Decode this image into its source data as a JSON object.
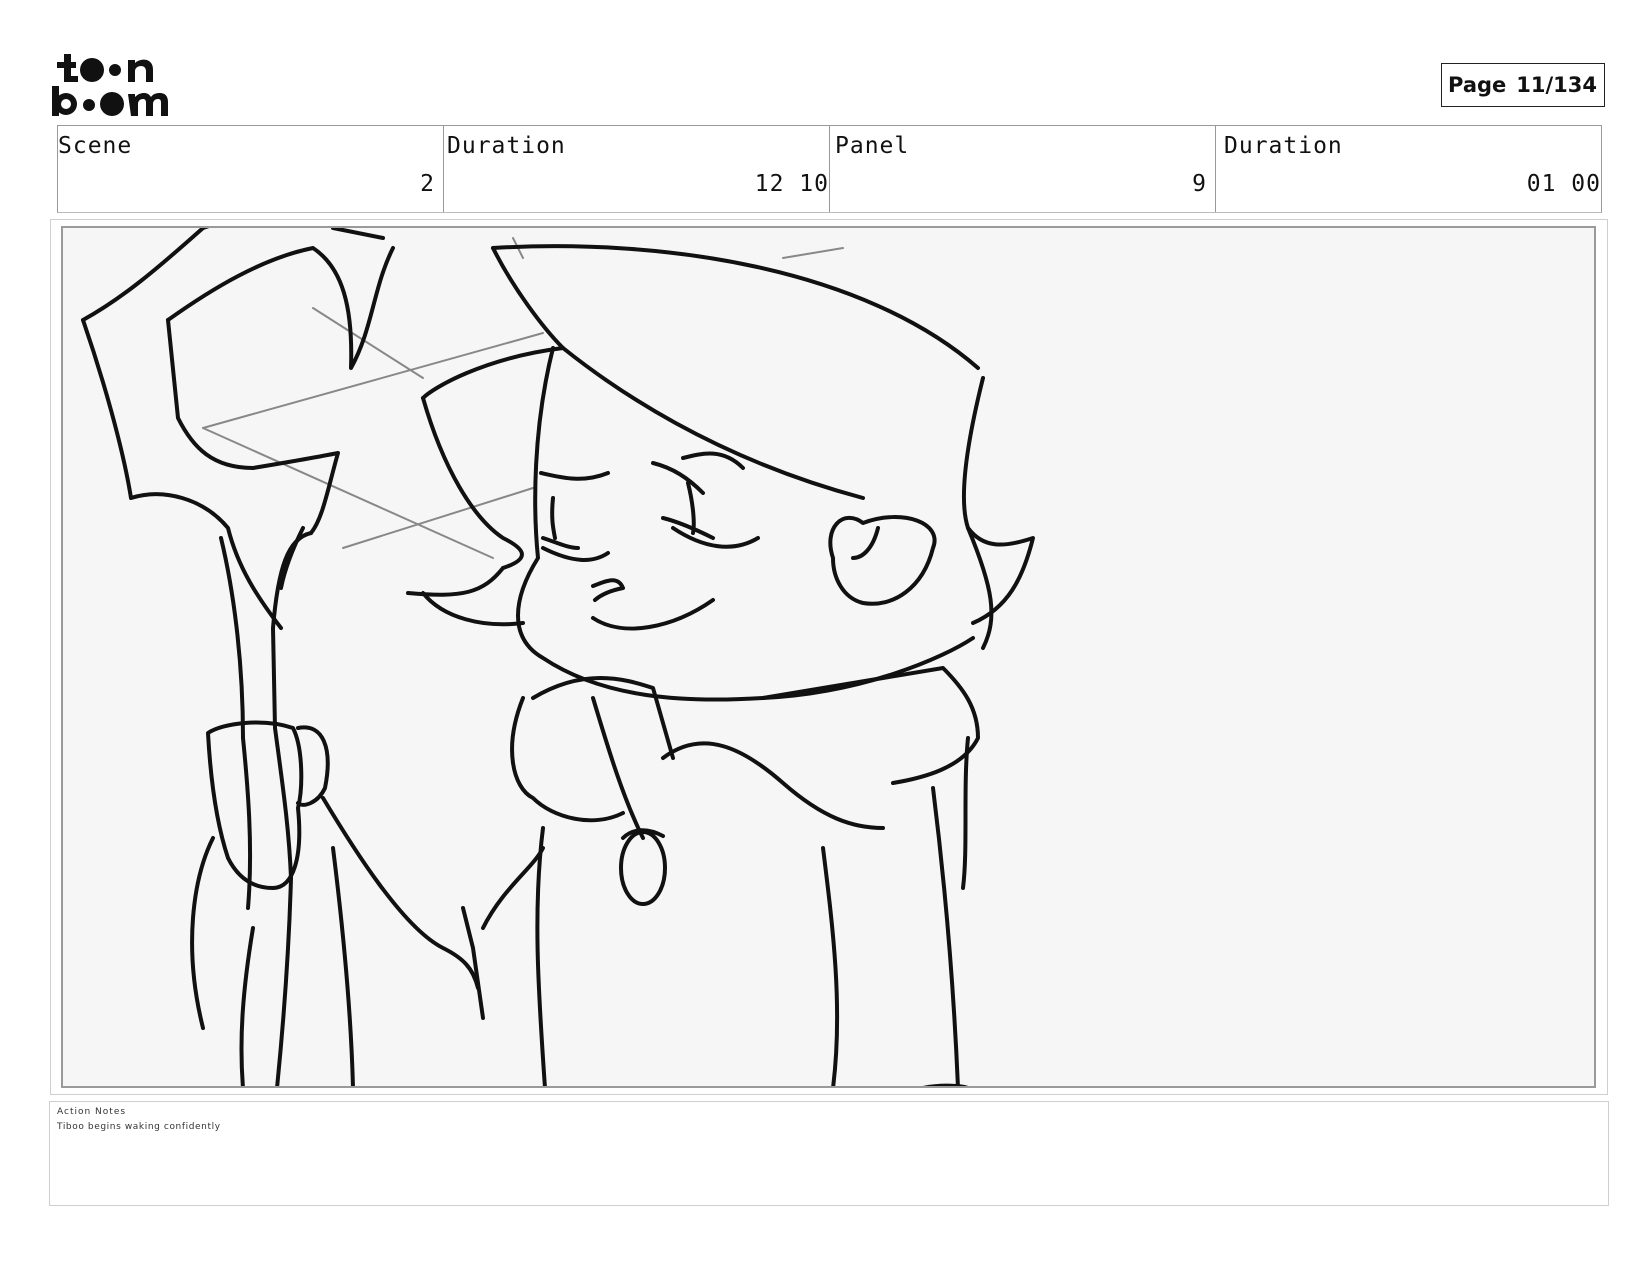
{
  "header": {
    "logo_text": "toon boom",
    "page_label": "Page",
    "page_number": "11/134"
  },
  "info": {
    "scene_label": "Scene",
    "scene_value": "2",
    "scene_duration_label": "Duration",
    "scene_duration_value": "12  10",
    "panel_label": "Panel",
    "panel_value": "9",
    "panel_duration_label": "Duration",
    "panel_duration_value": "01  00"
  },
  "notes": {
    "label": "Action Notes",
    "text": "Tiboo begins waking confidently"
  }
}
